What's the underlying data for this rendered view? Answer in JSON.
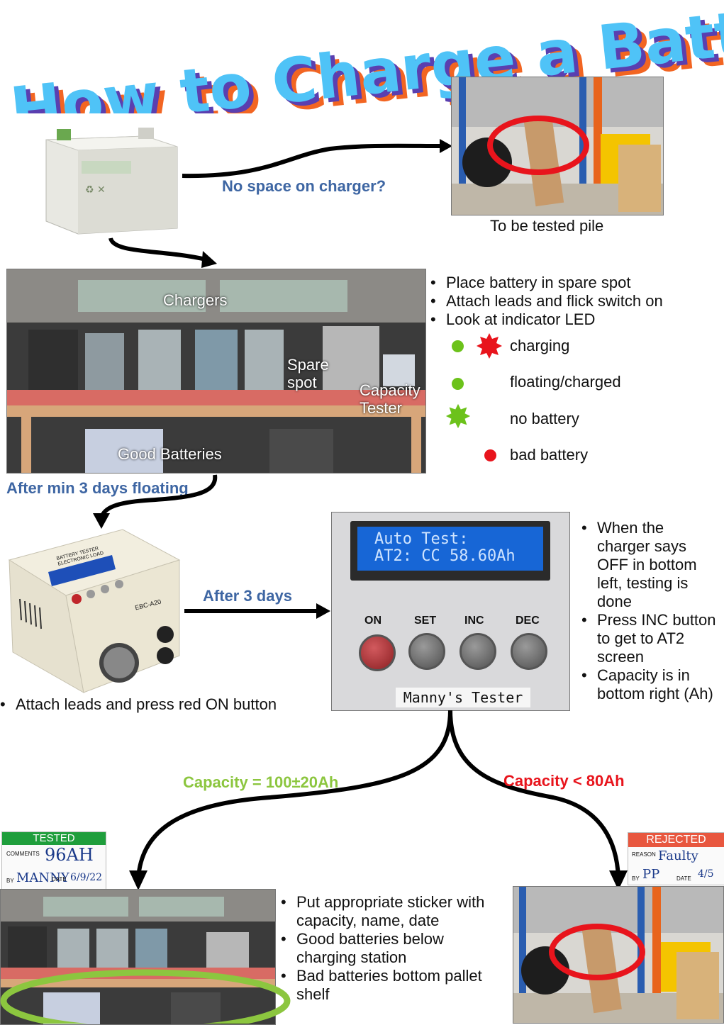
{
  "title": "How to Charge a Battery",
  "colors": {
    "title_fill": "#4fc3f7",
    "title_shadow1": "#5a3fb0",
    "title_shadow2": "#f26522",
    "label_blue": "#3e66a3",
    "label_green": "#8cc63f",
    "label_red": "#e8141c",
    "led_green": "#6cc21b",
    "led_red": "#e8141c"
  },
  "step1": {
    "arrow_label": "No space on charger?",
    "pile_caption": "To be tested pile"
  },
  "charging_station": {
    "labels": {
      "chargers": "Chargers",
      "spare_spot": "Spare\nspot",
      "spare_line1": "Spare",
      "spare_line2": "spot",
      "capacity_line1": "Capacity",
      "capacity_line2": "Tester",
      "good_batteries": "Good Batteries"
    },
    "instructions": [
      "Place battery in spare spot",
      "Attach leads and flick switch on",
      "Look at indicator LED"
    ],
    "legend": [
      {
        "icon": "green-dot-and-red-starburst-icon",
        "label": "charging"
      },
      {
        "icon": "green-dot-icon",
        "label": "floating/charged"
      },
      {
        "icon": "green-starburst-icon",
        "label": "no battery"
      },
      {
        "icon": "red-dot-icon",
        "label": "bad battery"
      }
    ],
    "after_label": "After min 3 days floating"
  },
  "tester": {
    "brand_line1": "BATTERY TESTER",
    "brand_line2": "ELECTRONIC LOAD",
    "model": "EBC-A20",
    "after_label": "After 3 days",
    "attach_instruction": "Attach leads and press red ON button",
    "screen_line1": "Auto Test:",
    "screen_line2": "AT2: CC 58.60Ah",
    "buttons": [
      "ON",
      "SET",
      "INC",
      "DEC"
    ],
    "nameplate": "Manny's Tester",
    "notes": [
      "When the charger says OFF in bottom left, testing is done",
      "Press INC button to get to AT2 screen",
      "Capacity is in bottom right (Ah)"
    ]
  },
  "outcomes": {
    "good_label": "Capacity = 100±20Ah",
    "bad_label": "Capacity < 80Ah",
    "tested_sticker": {
      "header": "TESTED",
      "comments_label": "COMMENTS",
      "comments_value": "96AH",
      "by_label": "BY",
      "by_value": "MANNY",
      "date_label": "DATE",
      "date_value": "6/9/22"
    },
    "rejected_sticker": {
      "header": "REJECTED",
      "reason_label": "REASON",
      "reason_value": "Faulty",
      "by_label": "BY",
      "by_value": "PP",
      "date_label": "DATE",
      "date_value": "4/5"
    },
    "final_notes": [
      "Put appropriate sticker with capacity, name, date",
      "Good batteries below charging station",
      "Bad batteries bottom pallet shelf"
    ]
  }
}
